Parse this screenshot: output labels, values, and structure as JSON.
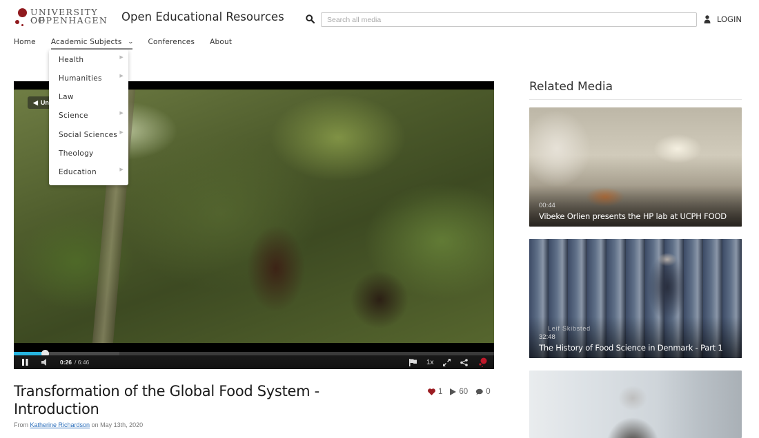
{
  "header": {
    "logo_line1": "UNIVERSITY OF",
    "logo_line2": "COPENHAGEN",
    "site_title": "Open Educational Resources",
    "search_placeholder": "Search all media",
    "login_label": "LOGIN",
    "brand_color": "#901a1e"
  },
  "nav": {
    "items": [
      {
        "label": "Home"
      },
      {
        "label": "Academic Subjects",
        "has_dropdown": true,
        "active": true
      },
      {
        "label": "Conferences"
      },
      {
        "label": "About"
      }
    ]
  },
  "dropdown": {
    "items": [
      {
        "label": "Health",
        "has_submenu": true
      },
      {
        "label": "Humanities",
        "has_submenu": true
      },
      {
        "label": "Law",
        "has_submenu": false
      },
      {
        "label": "Science",
        "has_submenu": true
      },
      {
        "label": "Social Sciences",
        "has_submenu": true
      },
      {
        "label": "Theology",
        "has_submenu": false
      },
      {
        "label": "Education",
        "has_submenu": true
      }
    ]
  },
  "player": {
    "unmute_label": "Unmute",
    "current_time": "0:26",
    "duration": "/ 6:46",
    "progress_fraction": 0.064,
    "buffered_fraction": 0.22,
    "speed_label": "1x",
    "progress_color": "#27b5e0"
  },
  "media": {
    "title": "Transformation of the Global Food System - Introduction",
    "byline_prefix": "From",
    "author": "Katherine Richardson",
    "byline_suffix": "on May 13th, 2020",
    "likes": "1",
    "plays": "60",
    "comments": "0"
  },
  "related": {
    "heading": "Related Media",
    "items": [
      {
        "duration": "00:44",
        "title": "Vibeke Orlien presents the HP lab at UCPH FOOD"
      },
      {
        "duration": "32:48",
        "title": "The History of Food Science in Denmark - Part 1",
        "overlay_text": "Leif Skibsted"
      },
      {
        "duration": "",
        "title": ""
      }
    ]
  }
}
